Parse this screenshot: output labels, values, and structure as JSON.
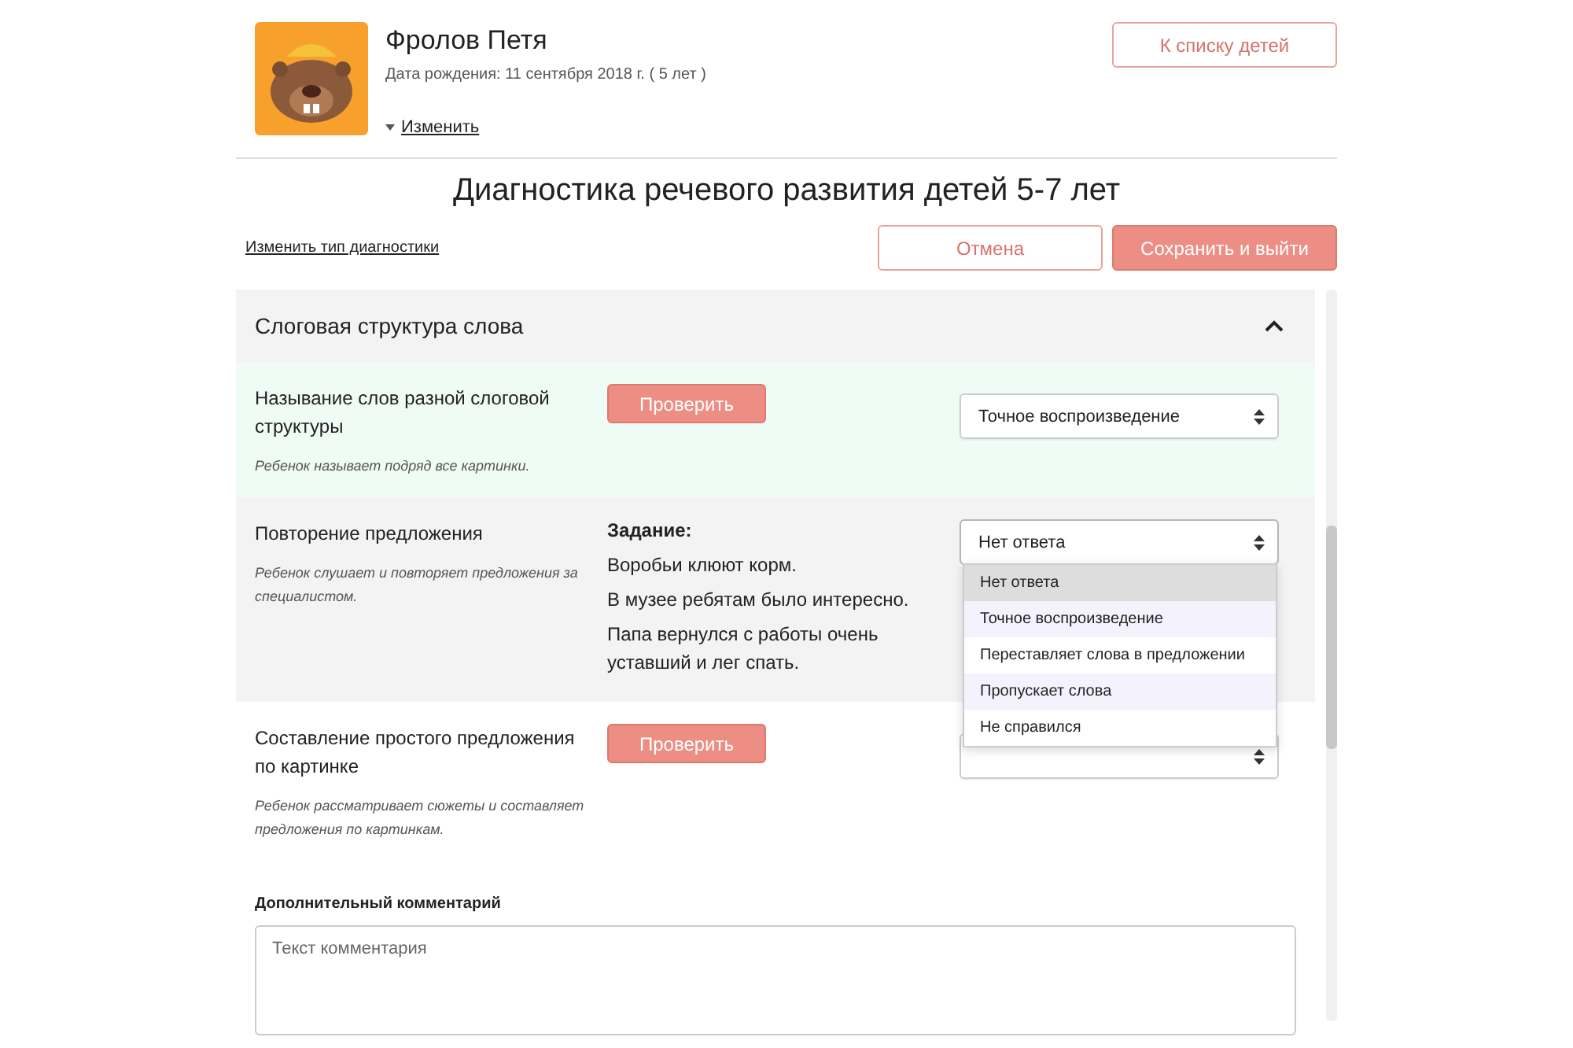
{
  "child": {
    "name": "Фролов Петя",
    "birth": "Дата рождения: 11 сентября 2018 г. ( 5 лет )",
    "edit_link": "Изменить",
    "back_button": "К списку детей"
  },
  "title": "Диагностика речевого развития детей 5-7 лет",
  "change_type_link": "Изменить тип диагностики",
  "buttons": [
    {
      "label": "Отмена",
      "kind": "outline"
    },
    {
      "label": "Сохранить и выйти",
      "kind": "primary"
    }
  ],
  "section": {
    "title": "Слоговая структура слова",
    "expanded": true
  },
  "items": [
    {
      "title": "Называние слов разной слоговой структуры",
      "hint": "Ребенок называет подряд все картинки.",
      "kind": "check",
      "button": "Проверить",
      "answered": true,
      "select": {
        "value": "Точное воспроизведение",
        "open": false
      }
    },
    {
      "title": "Повторение предложения",
      "hint": "Ребенок слушает и повторяет предложения за специалистом.",
      "kind": "task",
      "task_label": "Задание:",
      "sentences": [
        "Воробьи клюют корм.",
        "В музее ребятам было интересно.",
        "Папа вернулся с работы очень уставший и лег спать."
      ],
      "answered": false,
      "select": {
        "value": "Нет ответа",
        "open": true,
        "options": [
          {
            "label": "Нет ответа",
            "selected": true
          },
          {
            "label": "Точное воспроизведение",
            "selected": false
          },
          {
            "label": "Переставляет слова в предложении",
            "selected": false
          },
          {
            "label": "Пропускает слова",
            "selected": false
          },
          {
            "label": "Не справился",
            "selected": false
          }
        ]
      }
    },
    {
      "title": "Составление простого предложения по картинке",
      "hint": "Ребенок рассматривает сюжеты и составляет предложения по картинкам.",
      "kind": "check",
      "button": "Проверить",
      "answered": false,
      "select": {
        "open": false
      }
    }
  ],
  "comment": {
    "label": "Дополнительный комментарий",
    "placeholder": "Текст комментария"
  }
}
